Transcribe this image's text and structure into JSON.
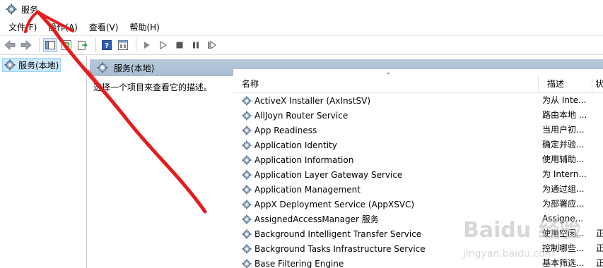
{
  "window": {
    "title": "服务"
  },
  "menu": [
    "文件(F)",
    "操作(A)",
    "查看(V)",
    "帮助(H)"
  ],
  "toolbar": {
    "buttons": [
      "back-icon",
      "forward-icon",
      "show-tree-icon",
      "refresh-icon",
      "export-icon",
      "help-icon",
      "properties-icon",
      "start-service-icon",
      "start-icon",
      "stop-icon",
      "pause-icon",
      "resume-icon"
    ]
  },
  "tree": {
    "root_label": "服务(本地)"
  },
  "pane": {
    "header": "服务(本地)",
    "description_hint": "选择一个项目来查看它的描述。"
  },
  "list": {
    "columns": {
      "name": "名称",
      "description": "描述",
      "status": "状"
    },
    "rows": [
      {
        "name": "ActiveX Installer (AxInstSV)",
        "description": "为从 Inte...",
        "status": ""
      },
      {
        "name": "AllJoyn Router Service",
        "description": "路由本地 ...",
        "status": ""
      },
      {
        "name": "App Readiness",
        "description": "当用户初...",
        "status": ""
      },
      {
        "name": "Application Identity",
        "description": "确定并验...",
        "status": ""
      },
      {
        "name": "Application Information",
        "description": "使用辅助...",
        "status": ""
      },
      {
        "name": "Application Layer Gateway Service",
        "description": "为 Intern...",
        "status": ""
      },
      {
        "name": "Application Management",
        "description": "为通过组...",
        "status": ""
      },
      {
        "name": "AppX Deployment Service (AppXSVC)",
        "description": "为部署应...",
        "status": ""
      },
      {
        "name": "AssignedAccessManager 服务",
        "description": "Assigne...",
        "status": ""
      },
      {
        "name": "Background Intelligent Transfer Service",
        "description": "使用空闲...",
        "status": "正"
      },
      {
        "name": "Background Tasks Infrastructure Service",
        "description": "控制哪些...",
        "status": "正"
      },
      {
        "name": "Base Filtering Engine",
        "description": "基本筛选...",
        "status": "正"
      }
    ]
  },
  "watermark": {
    "brand": "Baidu 经验",
    "url": "jingyan.baidu.com"
  },
  "colors": {
    "header_bg": "#b1c3d8",
    "selection_bg": "#cce8ff",
    "annotation": "#e41c1c"
  }
}
